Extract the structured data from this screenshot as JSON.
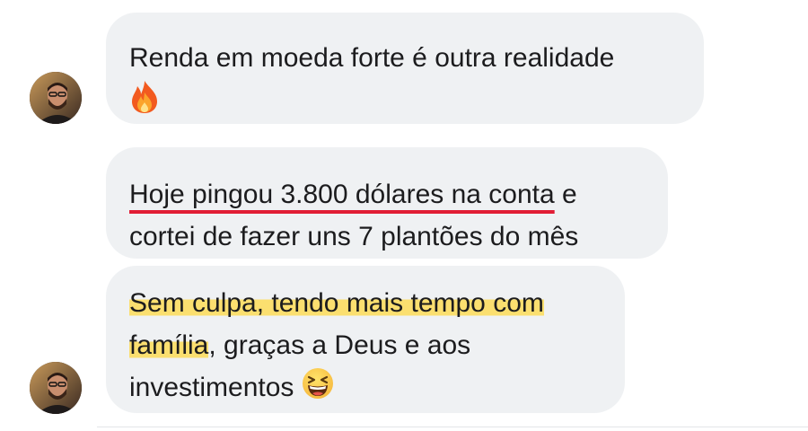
{
  "messages": [
    {
      "lines": [
        "Renda em moeda forte é outra realidade"
      ],
      "emoji": "fire-emoji"
    },
    {
      "underlined": "Hoje pingou 3.800 dólares na conta",
      "after_underline": " e",
      "line2": "cortei de fazer uns 7 plantões do mês"
    },
    {
      "highlight_line1": "Sem culpa, tendo mais tempo com",
      "highlight_line2": "família",
      "after_highlight": ", graças a Deus e aos",
      "line3": "investimentos",
      "emoji": "laughing-face-emoji"
    }
  ],
  "colors": {
    "bubble": "#eff1f3",
    "underline": "#e11d35",
    "highlight": "#fbdf6f",
    "text": "#1c1c1e"
  }
}
